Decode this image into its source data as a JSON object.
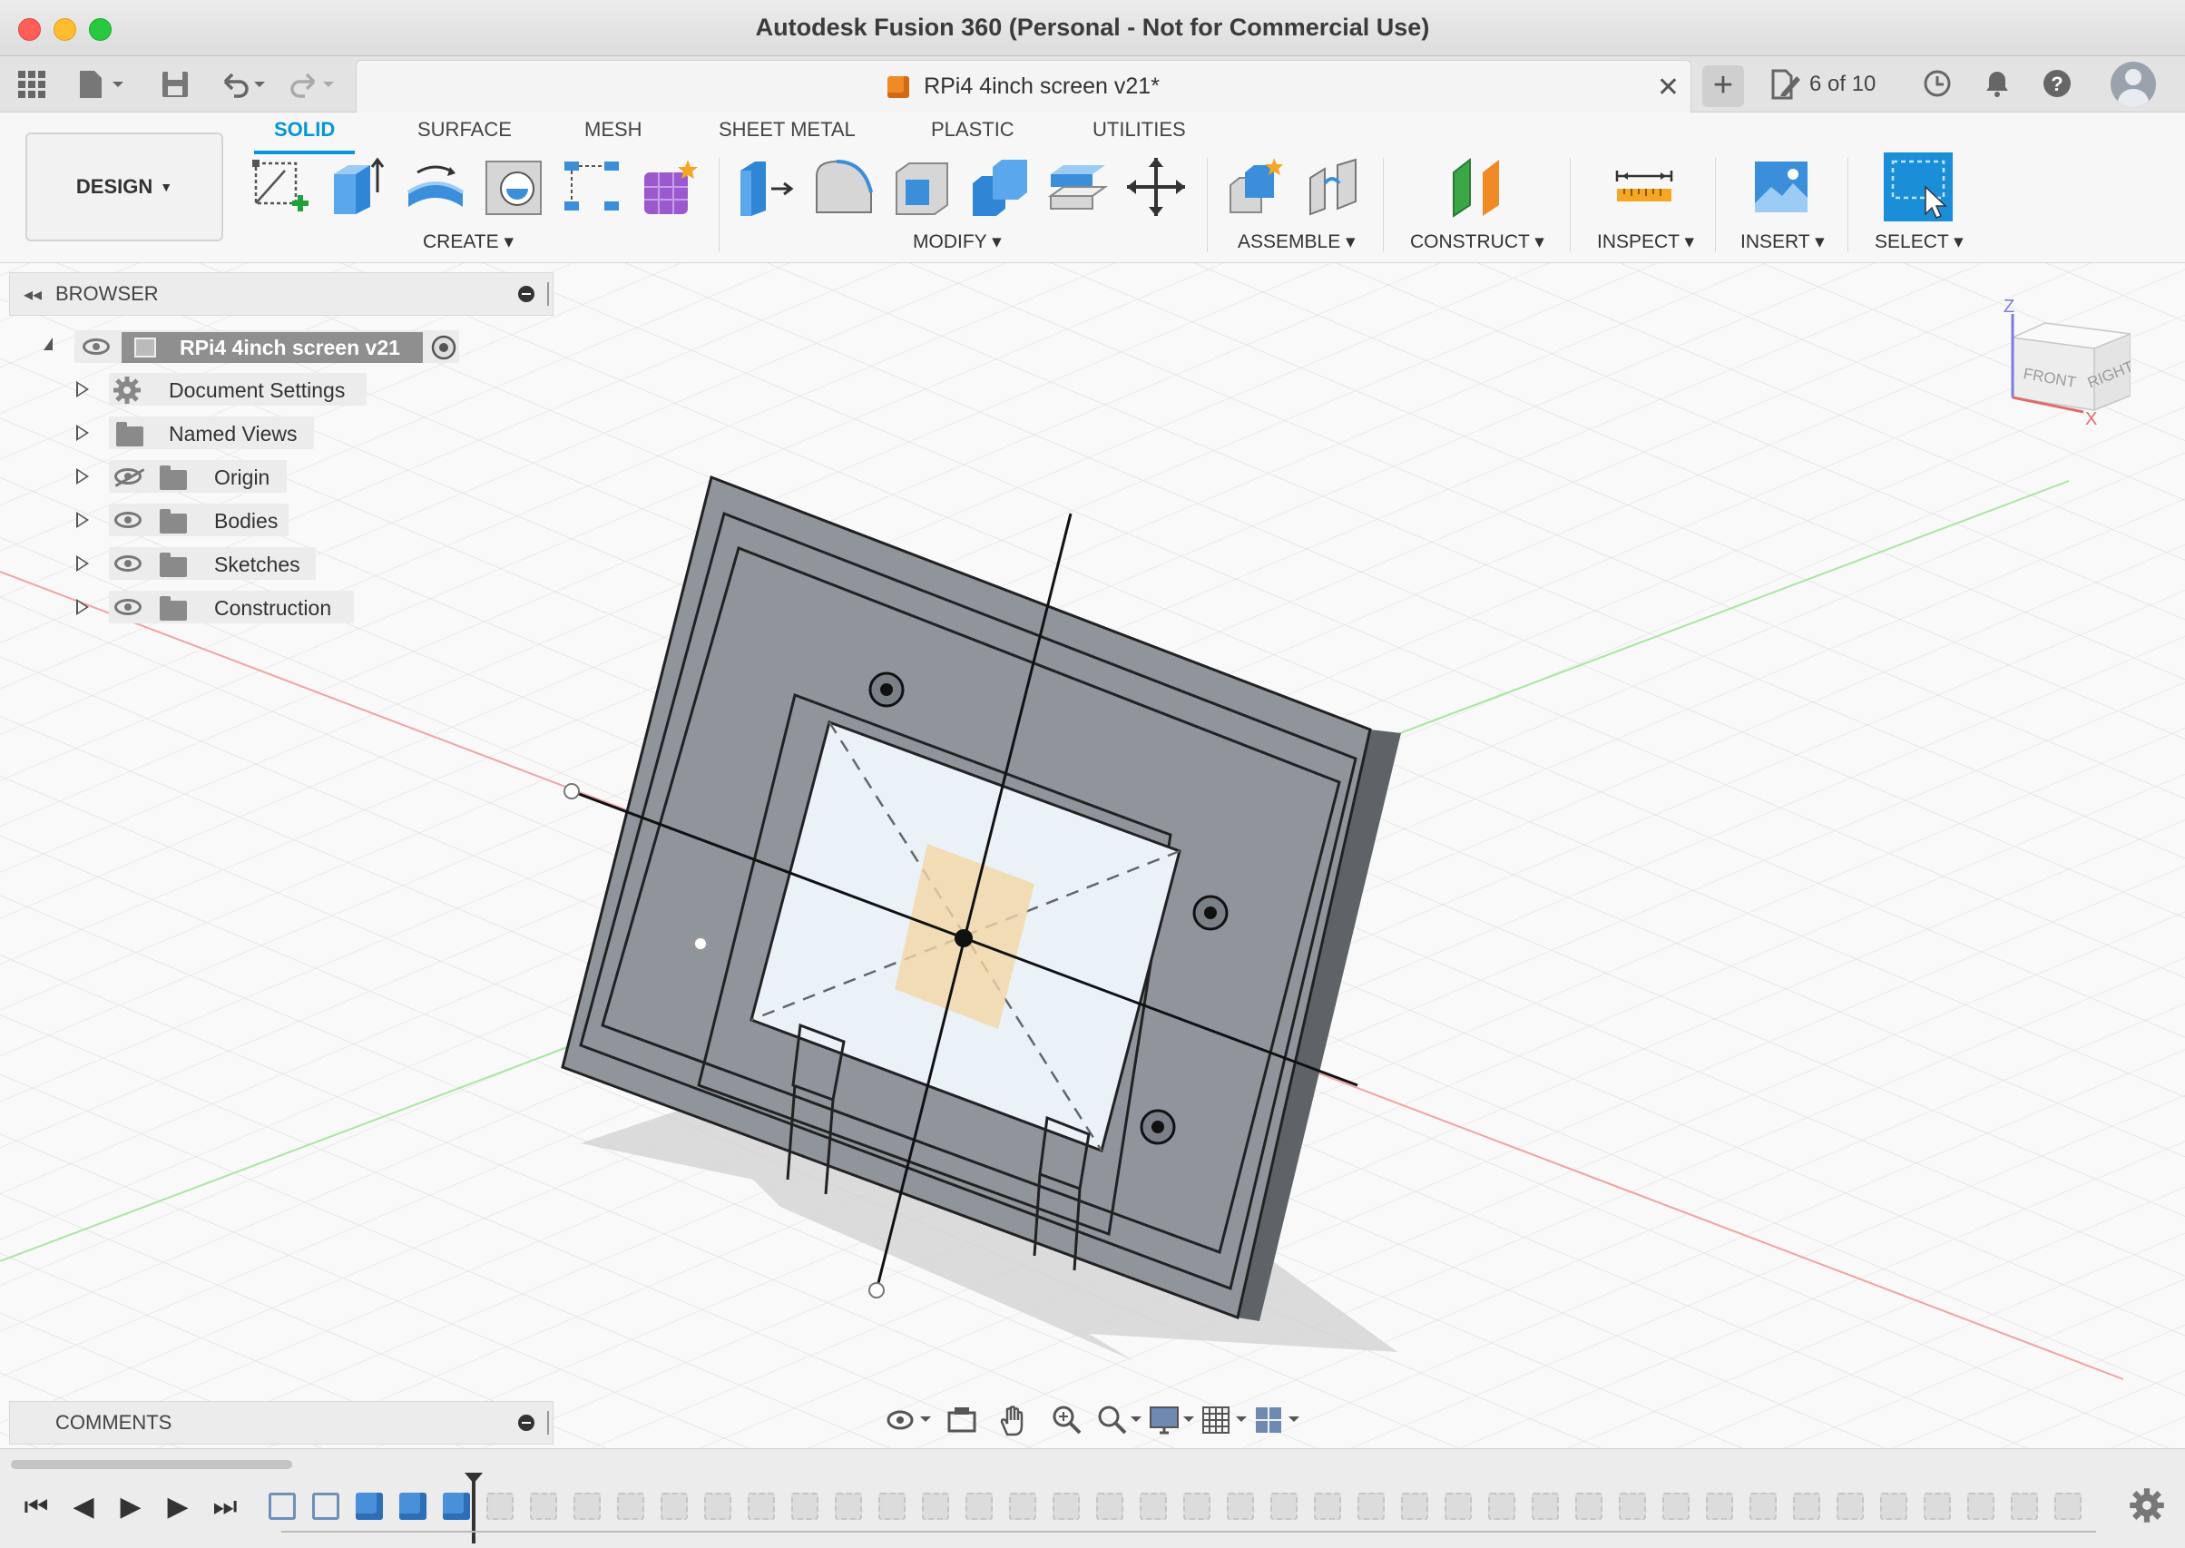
{
  "window": {
    "title": "Autodesk Fusion 360 (Personal - Not for Commercial Use)"
  },
  "document": {
    "tab_title": "RPi4 4inch screen v21*",
    "jobs_count": "6 of 10"
  },
  "ribbon": {
    "workspace": "DESIGN",
    "tabs": [
      "SOLID",
      "SURFACE",
      "MESH",
      "SHEET METAL",
      "PLASTIC",
      "UTILITIES"
    ],
    "active_tab": "SOLID",
    "groups": [
      "CREATE",
      "MODIFY",
      "ASSEMBLE",
      "CONSTRUCT",
      "INSPECT",
      "INSERT",
      "SELECT"
    ]
  },
  "browser": {
    "title": "BROWSER",
    "root": "RPi4 4inch screen v21",
    "items": [
      {
        "label": "Document Settings",
        "icon": "gear-icon"
      },
      {
        "label": "Named Views",
        "icon": "folder-icon"
      },
      {
        "label": "Origin",
        "icon": "folder-icon",
        "visible": false
      },
      {
        "label": "Bodies",
        "icon": "folder-icon",
        "visible": true
      },
      {
        "label": "Sketches",
        "icon": "folder-icon",
        "visible": true
      },
      {
        "label": "Construction",
        "icon": "folder-icon",
        "visible": true
      }
    ]
  },
  "comments": {
    "title": "COMMENTS"
  },
  "viewcube": {
    "front": "FRONT",
    "right": "RIGHT",
    "z": "Z",
    "x": "X"
  },
  "colors": {
    "accent": "#0696d7",
    "model": "#8f959a",
    "select": "#1a8fd8"
  }
}
